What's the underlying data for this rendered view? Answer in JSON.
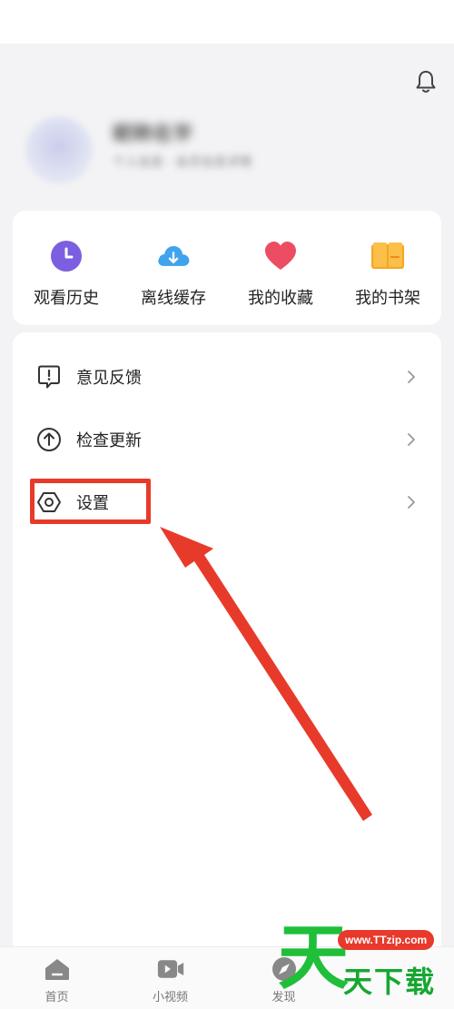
{
  "profile": {
    "username": "昵称名字",
    "subtitle": "个人信息 · 会员信息详情"
  },
  "quick_actions": [
    {
      "label": "观看历史",
      "icon": "clock-icon",
      "color": "#7b5fe0"
    },
    {
      "label": "离线缓存",
      "icon": "cloud-download-icon",
      "color": "#3fa3ee"
    },
    {
      "label": "我的收藏",
      "icon": "heart-icon",
      "color": "#ec4d62"
    },
    {
      "label": "我的书架",
      "icon": "book-icon",
      "color": "#f5a623"
    }
  ],
  "menu": [
    {
      "label": "意见反馈",
      "icon": "feedback-icon"
    },
    {
      "label": "检查更新",
      "icon": "update-icon"
    },
    {
      "label": "设置",
      "icon": "settings-icon"
    }
  ],
  "bottom_nav": [
    {
      "label": "首页",
      "icon": "home-icon"
    },
    {
      "label": "小视频",
      "icon": "video-icon"
    },
    {
      "label": "发现",
      "icon": "compass-icon"
    }
  ],
  "watermark": {
    "big_char": "天",
    "url": "www.TTzip.com",
    "text": "天下载"
  },
  "colors": {
    "annotation": "#e83a2a",
    "watermark_green": "#1fbf3a"
  }
}
